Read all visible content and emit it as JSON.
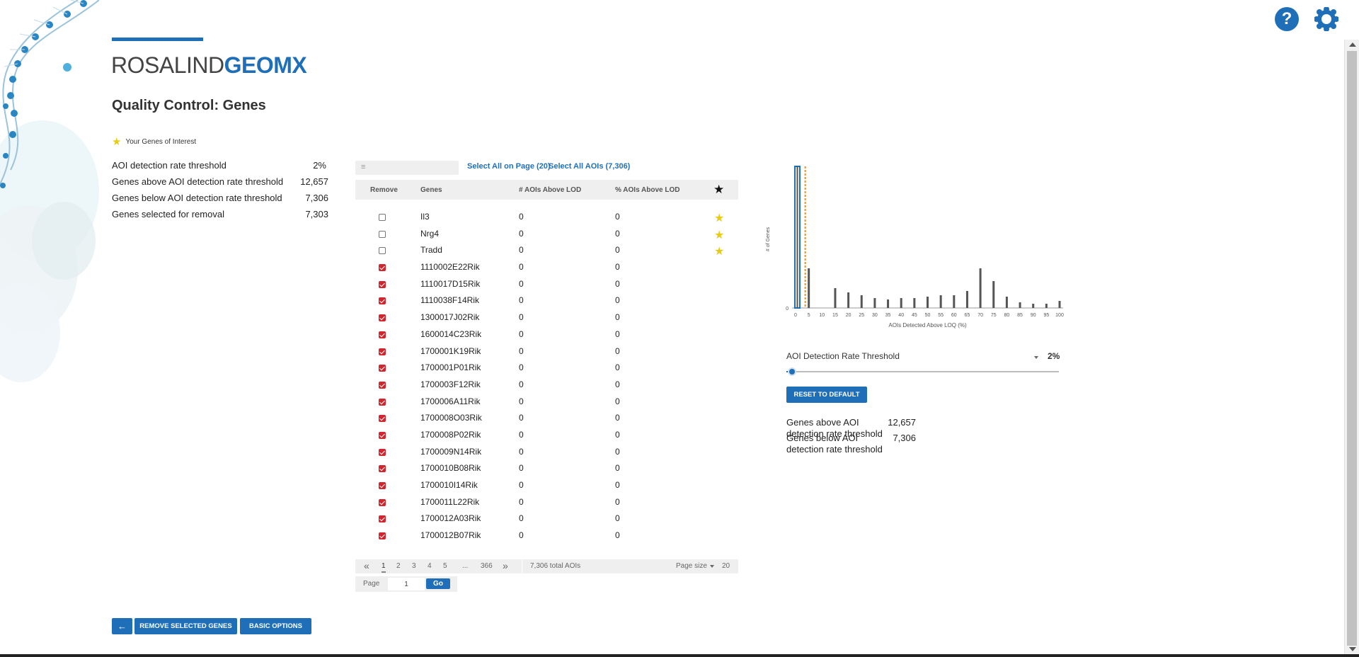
{
  "app": {
    "logo_part1": "ROSALIND",
    "logo_part2": "GEOMX",
    "page_title": "Quality Control: Genes",
    "help_label": "?"
  },
  "legend": {
    "label": "Your Genes of Interest"
  },
  "left_stats": [
    {
      "label": "AOI detection rate threshold",
      "value": "2%"
    },
    {
      "label": "Genes above AOI detection rate threshold",
      "value": "12,657"
    },
    {
      "label": "Genes below AOI detection rate threshold",
      "value": "7,306"
    },
    {
      "label": "Genes selected for removal",
      "value": "7,303"
    }
  ],
  "table": {
    "select_page_label": "Select All on Page (20)",
    "select_all_label": "Select All AOIs (7,306)",
    "headers": {
      "remove": "Remove",
      "genes": "Genes",
      "aois": "# AOIs Above LOD",
      "pct": "% AOIs Above LOD",
      "star": "★"
    },
    "rows": [
      {
        "gene": "Il3",
        "aois": "0",
        "pct": "0",
        "checked": false,
        "starred": true
      },
      {
        "gene": "Nrg4",
        "aois": "0",
        "pct": "0",
        "checked": false,
        "starred": true
      },
      {
        "gene": "Tradd",
        "aois": "0",
        "pct": "0",
        "checked": false,
        "starred": true
      },
      {
        "gene": "1110002E22Rik",
        "aois": "0",
        "pct": "0",
        "checked": true,
        "starred": false
      },
      {
        "gene": "1110017D15Rik",
        "aois": "0",
        "pct": "0",
        "checked": true,
        "starred": false
      },
      {
        "gene": "1110038F14Rik",
        "aois": "0",
        "pct": "0",
        "checked": true,
        "starred": false
      },
      {
        "gene": "1300017J02Rik",
        "aois": "0",
        "pct": "0",
        "checked": true,
        "starred": false
      },
      {
        "gene": "1600014C23Rik",
        "aois": "0",
        "pct": "0",
        "checked": true,
        "starred": false
      },
      {
        "gene": "1700001K19Rik",
        "aois": "0",
        "pct": "0",
        "checked": true,
        "starred": false
      },
      {
        "gene": "1700001P01Rik",
        "aois": "0",
        "pct": "0",
        "checked": true,
        "starred": false
      },
      {
        "gene": "1700003F12Rik",
        "aois": "0",
        "pct": "0",
        "checked": true,
        "starred": false
      },
      {
        "gene": "1700006A11Rik",
        "aois": "0",
        "pct": "0",
        "checked": true,
        "starred": false
      },
      {
        "gene": "1700008O03Rik",
        "aois": "0",
        "pct": "0",
        "checked": true,
        "starred": false
      },
      {
        "gene": "1700008P02Rik",
        "aois": "0",
        "pct": "0",
        "checked": true,
        "starred": false
      },
      {
        "gene": "1700009N14Rik",
        "aois": "0",
        "pct": "0",
        "checked": true,
        "starred": false
      },
      {
        "gene": "1700010B08Rik",
        "aois": "0",
        "pct": "0",
        "checked": true,
        "starred": false
      },
      {
        "gene": "1700010I14Rik",
        "aois": "0",
        "pct": "0",
        "checked": true,
        "starred": false
      },
      {
        "gene": "1700011L22Rik",
        "aois": "0",
        "pct": "0",
        "checked": true,
        "starred": false
      },
      {
        "gene": "1700012A03Rik",
        "aois": "0",
        "pct": "0",
        "checked": true,
        "starred": false
      },
      {
        "gene": "1700012B07Rik",
        "aois": "0",
        "pct": "0",
        "checked": true,
        "starred": false
      }
    ]
  },
  "pagination": {
    "first": "«",
    "last": "»",
    "pages": [
      "1",
      "2",
      "3",
      "4",
      "5",
      "...",
      "366"
    ],
    "current": "1",
    "total_label": "7,306 total AOIs",
    "page_size_label": "Page size",
    "page_size_value": "20",
    "goto_label": "Page",
    "goto_value": "1",
    "go_label": "Go"
  },
  "chart_data": {
    "type": "bar",
    "xlabel": "AOIs Detected Above LOQ (%)",
    "ylabel": "# of Genes",
    "x_ticks": [
      0,
      5,
      10,
      15,
      20,
      25,
      30,
      35,
      40,
      45,
      50,
      55,
      60,
      65,
      70,
      75,
      80,
      85,
      90,
      95,
      100
    ],
    "y_ticks": [
      0
    ],
    "xlim": [
      0,
      100
    ],
    "ylim": [
      0,
      100
    ],
    "x": [
      0,
      5,
      15,
      20,
      25,
      30,
      35,
      40,
      45,
      50,
      55,
      60,
      65,
      70,
      75,
      80,
      85,
      90,
      95,
      100
    ],
    "values": [
      100,
      28,
      14,
      11,
      9,
      7,
      6,
      7,
      7,
      8,
      9,
      9,
      12,
      28,
      19,
      8,
      4,
      3,
      3,
      5
    ],
    "threshold": 5,
    "colors": {
      "bar": "#555555",
      "first_bar_outline": "#1f6fb8",
      "threshold": "#f0901c"
    }
  },
  "slider": {
    "label": "AOI Detection Rate Threshold",
    "value": "2%",
    "fraction": 0.02
  },
  "reset_label": "RESET TO DEFAULT",
  "right_stats": [
    {
      "label": "Genes above AOI detection rate threshold",
      "value": "12,657"
    },
    {
      "label": "Genes below AOI detection rate threshold",
      "value": "7,306"
    }
  ],
  "buttons": {
    "back": "←",
    "remove": "REMOVE SELECTED GENES",
    "basic": "BASIC OPTIONS"
  },
  "colors": {
    "brand": "#1f6fb8",
    "checkbox": "#d0262d",
    "star": "#e6cc17"
  }
}
